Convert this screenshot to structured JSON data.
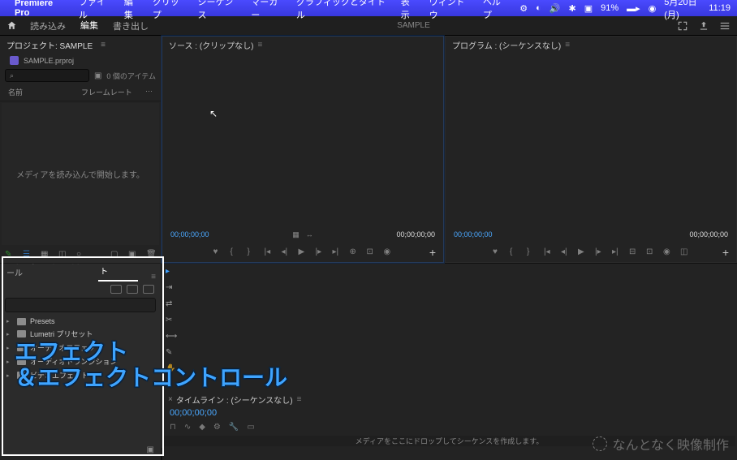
{
  "menubar": {
    "app": "Premiere Pro",
    "items": [
      "ファイル",
      "編集",
      "クリップ",
      "シーケンス",
      "マーカー",
      "グラフィックとタイトル",
      "表示",
      "ウィンドウ",
      "ヘルプ"
    ],
    "battery": "91%",
    "date": "5月20日(月)",
    "time": "11:19"
  },
  "workspace": {
    "tabs": {
      "import": "読み込み",
      "edit": "編集",
      "export": "書き出し"
    },
    "title": "SAMPLE"
  },
  "project": {
    "title": "プロジェクト: SAMPLE",
    "file": "SAMPLE.prproj",
    "search_placeholder": "",
    "item_count": "0 個のアイテム",
    "columns": {
      "name": "名前",
      "framerate": "フレームレート"
    },
    "empty": "メディアを読み込んで開始します。"
  },
  "source": {
    "title": "ソース : (クリップなし)",
    "tc_left": "00;00;00;00",
    "tc_right": "00;00;00;00"
  },
  "program": {
    "title": "プログラム : (シーケンスなし)",
    "tc_left": "00;00;00;00",
    "tc_right": "00;00;00;00"
  },
  "effects": {
    "tabs": {
      "controls": "エフェクトコントロール",
      "effects": "エフェクト"
    },
    "items": [
      "Presets",
      "Lumetri プリセット",
      "オーディオエフェクト",
      "オーディオトランジション",
      "ビデオエフェクト"
    ]
  },
  "timeline": {
    "title": "タイムライン : (シーケンスなし)",
    "tc": "00;00;00;00",
    "empty": "メディアをここにドロップしてシーケンスを作成します。"
  },
  "annotation": {
    "line1": "エフェクト",
    "line2": "＆エフェクトコントロール"
  },
  "watermark": "なんとなく映像制作"
}
